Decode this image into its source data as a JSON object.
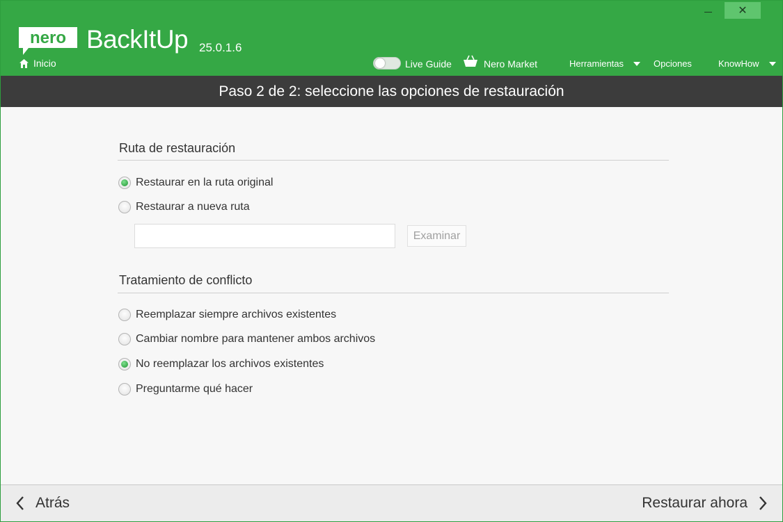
{
  "window": {
    "minimize_glyph": "",
    "close_glyph": "✕"
  },
  "header": {
    "logo_text": "nero",
    "app_name": "BackItUp",
    "version": "25.0.1.6",
    "home_label": "Inicio",
    "live_guide_label": "Live Guide",
    "live_guide_enabled": false,
    "market_label": "Nero Market",
    "tools_label": "Herramientas",
    "options_label": "Opciones",
    "knowhow_label": "KnowHow"
  },
  "step": {
    "title": "Paso 2 de 2: seleccione las opciones de restauración"
  },
  "restore_path": {
    "section_title": "Ruta de restauración",
    "options": [
      {
        "label": "Restaurar en la ruta original",
        "checked": true
      },
      {
        "label": "Restaurar a nueva ruta",
        "checked": false
      }
    ],
    "path_value": "",
    "browse_label": "Examinar"
  },
  "conflict": {
    "section_title": "Tratamiento de conflicto",
    "options": [
      {
        "label": "Reemplazar siempre archivos existentes",
        "checked": false
      },
      {
        "label": "Cambiar nombre para mantener ambos archivos",
        "checked": false
      },
      {
        "label": "No reemplazar los archivos existentes",
        "checked": true
      },
      {
        "label": "Preguntarme qué hacer",
        "checked": false
      }
    ]
  },
  "footer": {
    "back_label": "Atrás",
    "restore_label": "Restaurar ahora"
  },
  "colors": {
    "header_green": "#35a845",
    "step_bar": "#3c3c3c",
    "radio_checked": "#1e9431"
  },
  "icons": {
    "home": "home-icon",
    "basket": "basket-icon",
    "back": "chevron-left-icon",
    "next": "chevron-right-icon"
  }
}
